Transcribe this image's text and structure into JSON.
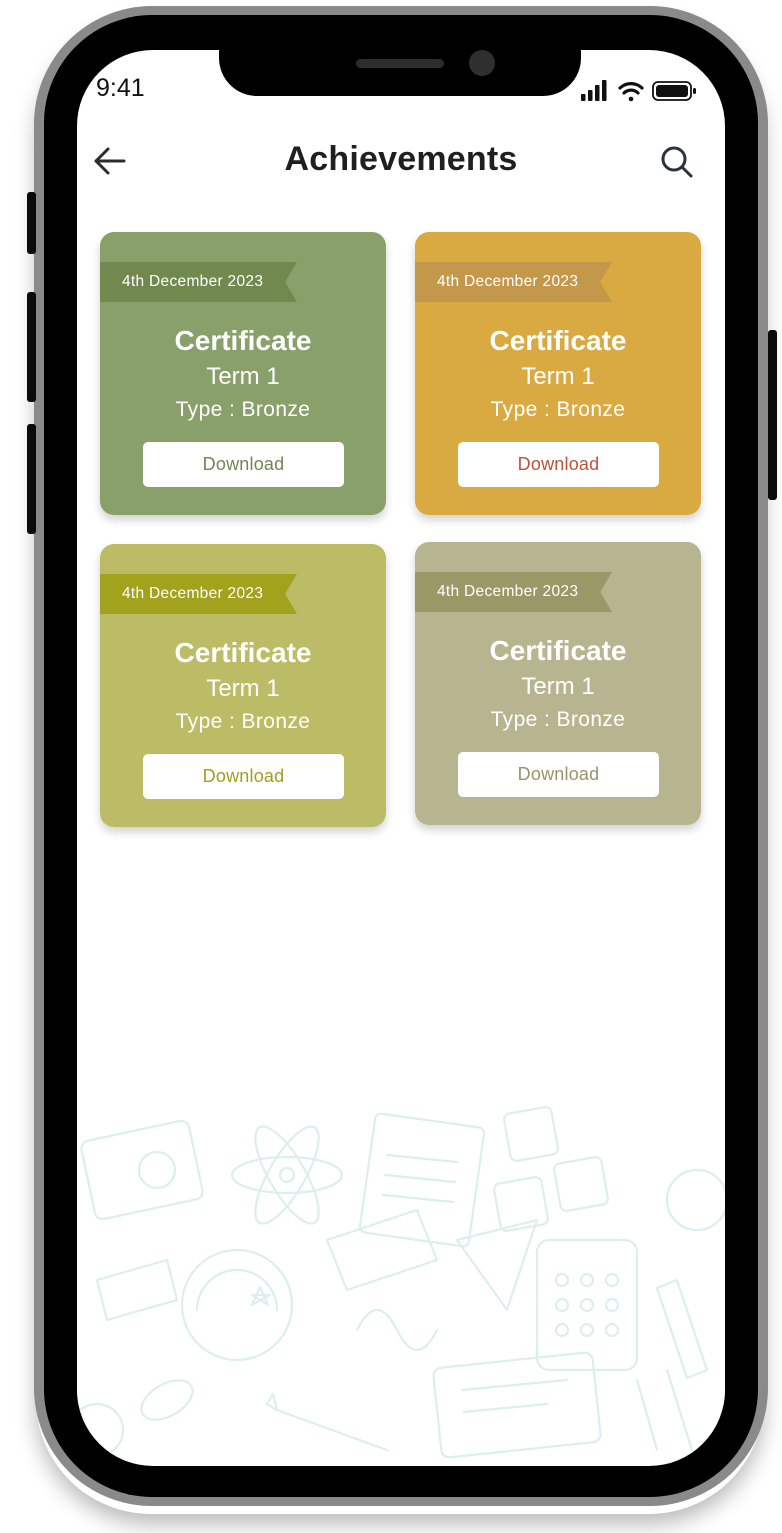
{
  "status_bar": {
    "time": "9:41"
  },
  "header": {
    "title": "Achievements"
  },
  "cards": [
    {
      "date": "4th December 2023",
      "title": "Certificate",
      "term": "Term 1",
      "type": "Type : Bronze",
      "download_label": "Download",
      "colors": {
        "card": "#8aa06a",
        "ribbon": "#71894f",
        "button_text": "#6f8650"
      }
    },
    {
      "date": "4th December 2023",
      "title": "Certificate",
      "term": "Term 1",
      "type": "Type : Bronze",
      "download_label": "Download",
      "colors": {
        "card": "#d9aa41",
        "ribbon": "#c3984a",
        "button_text": "#b8523a"
      }
    },
    {
      "date": "4th December 2023",
      "title": "Certificate",
      "term": "Term 1",
      "type": "Type : Bronze",
      "download_label": "Download",
      "colors": {
        "card": "#bcbc66",
        "ribbon": "#a2a21c",
        "button_text": "#a0a01c"
      }
    },
    {
      "date": "4th December 2023",
      "title": "Certificate",
      "term": "Term 1",
      "type": "Type : Bronze",
      "download_label": "Download",
      "colors": {
        "card": "#b7b58f",
        "ribbon": "#9b9868",
        "button_text": "#969468"
      }
    }
  ],
  "icons": {
    "back": "arrow-left-icon",
    "search": "search-icon",
    "signal": "signal-bars-icon",
    "wifi": "wifi-icon",
    "battery": "battery-icon"
  }
}
